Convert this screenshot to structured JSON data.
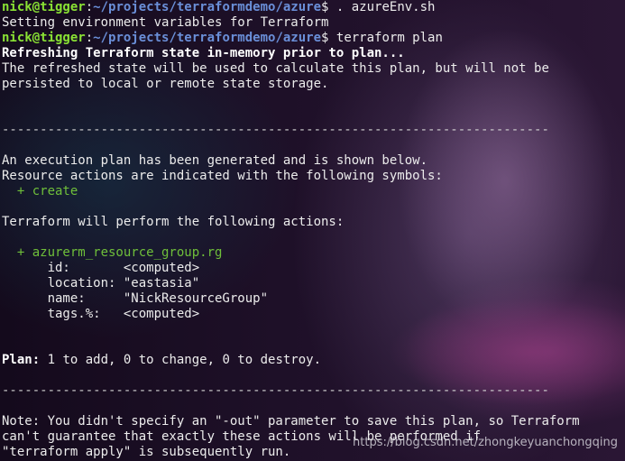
{
  "prompt": {
    "user_host": "nick@tigger",
    "separator": ":",
    "path": "~/projects/terraformdemo/azure",
    "symbol": "$ "
  },
  "commands": [
    ". azureEnv.sh",
    "terraform plan"
  ],
  "output": {
    "env_message": "Setting environment variables for Terraform",
    "refresh_heading": "Refreshing Terraform state in-memory prior to plan...",
    "refresh_note_1": "The refreshed state will be used to calculate this plan, but will not be",
    "refresh_note_2": "persisted to local or remote state storage.",
    "separator": "------------------------------------------------------------------------",
    "plan_generated": "An execution plan has been generated and is shown below.",
    "symbols_intro": "Resource actions are indicated with the following symbols:",
    "symbol_create": "  + create",
    "actions_intro": "Terraform will perform the following actions:",
    "resource_line": "  + azurerm_resource_group.rg",
    "attributes": [
      {
        "key": "      id:       ",
        "value": "<computed>"
      },
      {
        "key": "      location: ",
        "value": "\"eastasia\""
      },
      {
        "key": "      name:     ",
        "value": "\"NickResourceGroup\""
      },
      {
        "key": "      tags.%:   ",
        "value": "<computed>"
      }
    ],
    "plan_label": "Plan:",
    "plan_summary": " 1 to add, 0 to change, 0 to destroy.",
    "note_1": "Note: You didn't specify an \"-out\" parameter to save this plan, so Terraform",
    "note_2": "can't guarantee that exactly these actions will be performed if",
    "note_3": "\"terraform apply\" is subsequently run."
  },
  "watermark": "https://blog.csdn.net/zhongkeyuanchongqing",
  "colors": {
    "prompt_user": "#8ae234",
    "prompt_path": "#6a8fd8",
    "resource_green": "#6fbf3a",
    "text": "#ececec"
  }
}
